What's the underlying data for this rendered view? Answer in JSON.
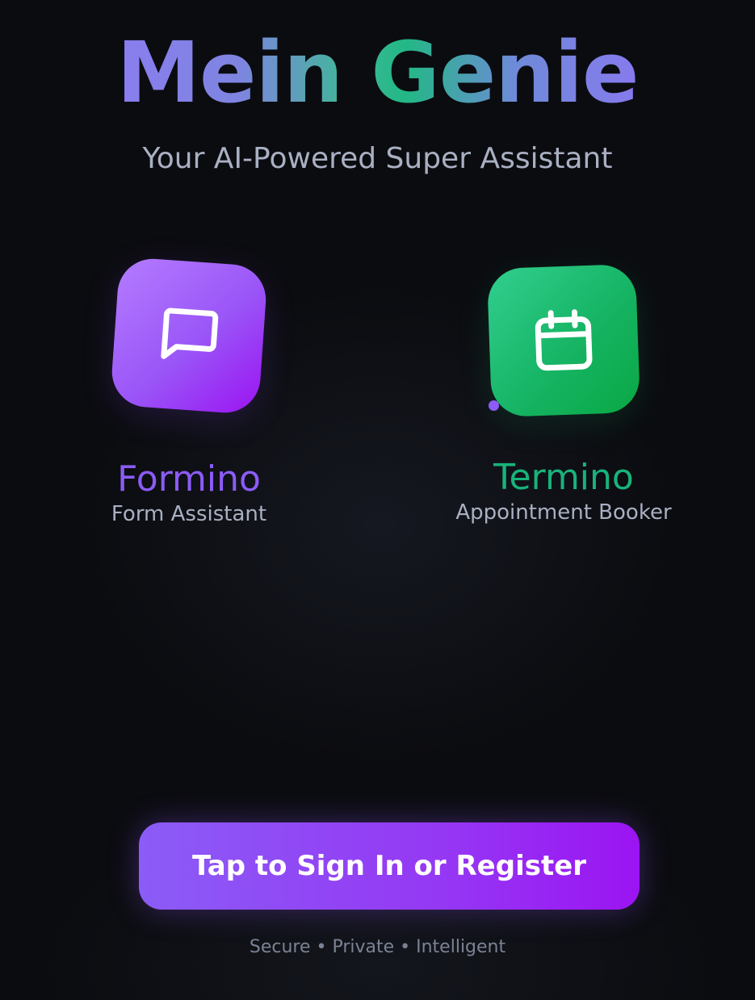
{
  "header": {
    "title": "Mein Genie",
    "subtitle": "Your AI-Powered Super Assistant"
  },
  "apps": [
    {
      "name": "Formino",
      "description": "Form Assistant",
      "icon": "message-square-icon",
      "color": "#8b5cf6"
    },
    {
      "name": "Termino",
      "description": "Appointment Booker",
      "icon": "calendar-icon",
      "color": "#18b37a"
    }
  ],
  "signin": {
    "label": "Tap to Sign In or Register"
  },
  "footer": {
    "tagline": "Secure • Private • Intelligent"
  },
  "colors": {
    "background": "#0b0c10",
    "accent_purple": "#8b5cf6",
    "accent_green": "#18b37a",
    "muted_text": "#a9b0c2"
  }
}
